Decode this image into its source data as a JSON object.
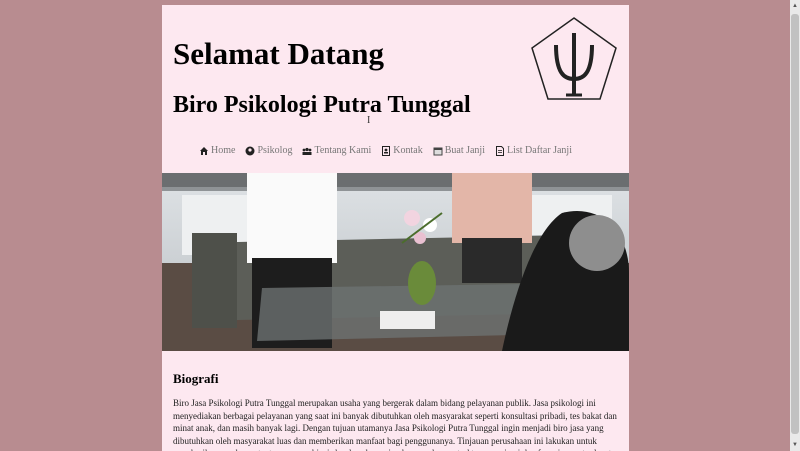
{
  "header": {
    "welcome": "Selamat Datang",
    "bureau_name": "Biro Psikologi Putra Tunggal",
    "logo_icon": "psi-logo-icon"
  },
  "nav": {
    "items": [
      {
        "label": "Home",
        "icon": "home-icon"
      },
      {
        "label": "Psikolog",
        "icon": "person-icon"
      },
      {
        "label": "Tentang Kami",
        "icon": "group-icon"
      },
      {
        "label": "Kontak",
        "icon": "contact-icon"
      },
      {
        "label": "Buat Janji",
        "icon": "calendar-icon"
      },
      {
        "label": "List Daftar Janji",
        "icon": "list-icon"
      }
    ]
  },
  "hero": {
    "icon": "counseling-photo"
  },
  "biography": {
    "title": "Biografi",
    "text": "Biro Jasa Psikologi Putra Tunggal merupakan usaha yang bergerak dalam bidang pelayanan publik. Jasa psikologi ini menyediakan berbagai pelayanan yang saat ini banyak dibutuhkan oleh masyarakat seperti konsultasi pribadi, tes bakat dan minat anak, dan masih banyak lagi. Dengan tujuan utamanya Jasa Psikologi Putra Tunggal ingin menjadi biro jasa yang dibutuhkan oleh masyarakat luas dan memberikan manfaat bagi penggunanya. Tinjauan perusahaan ini lakukan untuk memberikan gambaran tentang proses bisnis berdasarkan sejarah perusahaan, struktur organisasi dan fungsi yang terdapat"
  },
  "colors": {
    "background": "#b88c90",
    "page": "#fde8f0",
    "nav_text": "#777777"
  }
}
